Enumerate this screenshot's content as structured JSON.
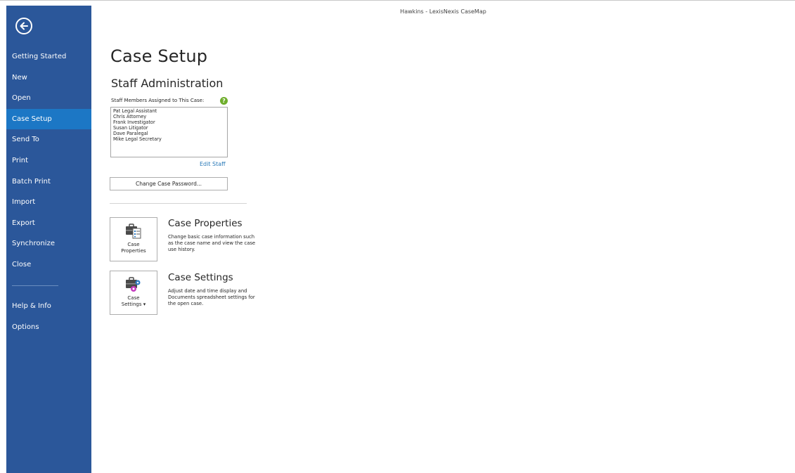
{
  "window": {
    "title": "Hawkins - LexisNexis CaseMap"
  },
  "sidebar": {
    "items": [
      {
        "label": "Getting Started",
        "active": false
      },
      {
        "label": "New",
        "active": false
      },
      {
        "label": "Open",
        "active": false
      },
      {
        "label": "Case Setup",
        "active": true
      },
      {
        "label": "Send To",
        "active": false
      },
      {
        "label": "Print",
        "active": false
      },
      {
        "label": "Batch Print",
        "active": false
      },
      {
        "label": "Import",
        "active": false
      },
      {
        "label": "Export",
        "active": false
      },
      {
        "label": "Synchronize",
        "active": false
      },
      {
        "label": "Close",
        "active": false
      }
    ],
    "items_bottom": [
      {
        "label": "Help & Info"
      },
      {
        "label": "Options"
      }
    ]
  },
  "main": {
    "title": "Case Setup",
    "staff": {
      "heading": "Staff Administration",
      "list_label": "Staff Members Assigned to This Case:",
      "members": [
        "Pat Legal Assistant",
        "Chris Attorney",
        "Frank Investigator",
        "Susan Litigator",
        "Dave Paralegal",
        "Mike Legal Secretary"
      ],
      "edit_link": "Edit Staff",
      "password_button": "Change Case Password..."
    },
    "case_properties": {
      "tile_label_1": "Case",
      "tile_label_2": "Properties",
      "title": "Case Properties",
      "description": "Change basic case information such as the case name and view the case use history."
    },
    "case_settings": {
      "tile_label_1": "Case",
      "tile_label_2": "Settings ▾",
      "title": "Case Settings",
      "description": "Adjust date and time display and Documents spreadsheet settings for the open case."
    }
  },
  "colors": {
    "sidebar": "#2b579a",
    "sidebar_active": "#1c77c5",
    "link": "#2a7ab8",
    "help_icon": "#6fae2c"
  }
}
